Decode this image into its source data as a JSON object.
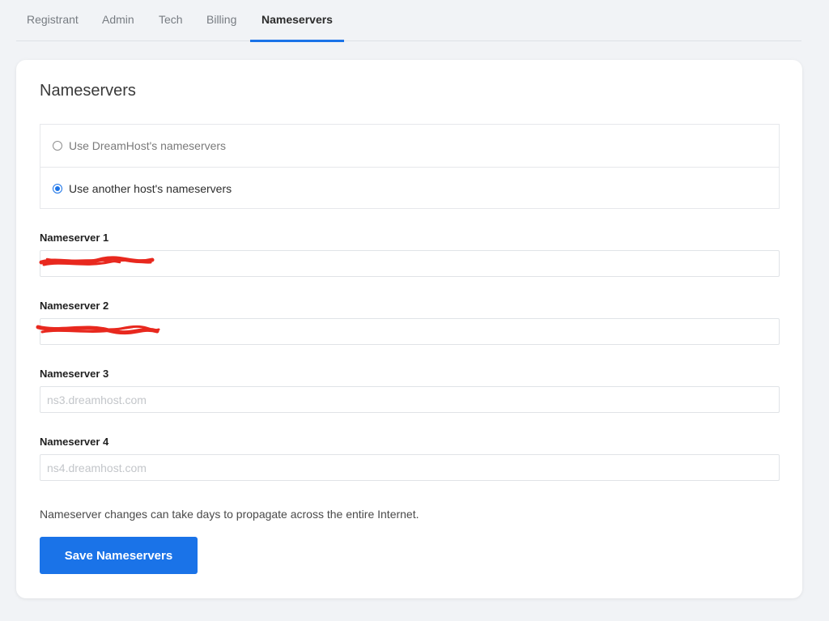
{
  "tabs": [
    {
      "label": "Registrant",
      "active": false
    },
    {
      "label": "Admin",
      "active": false
    },
    {
      "label": "Tech",
      "active": false
    },
    {
      "label": "Billing",
      "active": false
    },
    {
      "label": "Nameservers",
      "active": true
    }
  ],
  "card": {
    "title": "Nameservers",
    "options": [
      {
        "label": "Use DreamHost's nameservers",
        "checked": false
      },
      {
        "label": "Use another host's nameservers",
        "checked": true
      }
    ],
    "fields": [
      {
        "label": "Nameserver 1",
        "value": "",
        "placeholder": "",
        "redacted": true
      },
      {
        "label": "Nameserver 2",
        "value": "",
        "placeholder": "",
        "redacted": true
      },
      {
        "label": "Nameserver 3",
        "value": "",
        "placeholder": "ns3.dreamhost.com",
        "redacted": false
      },
      {
        "label": "Nameserver 4",
        "value": "",
        "placeholder": "ns4.dreamhost.com",
        "redacted": false
      }
    ],
    "note": "Nameserver changes can take days to propagate across the entire Internet.",
    "save_label": "Save Nameservers"
  },
  "colors": {
    "accent": "#1a73e8",
    "redaction": "#e8281e",
    "background": "#f1f3f6"
  }
}
